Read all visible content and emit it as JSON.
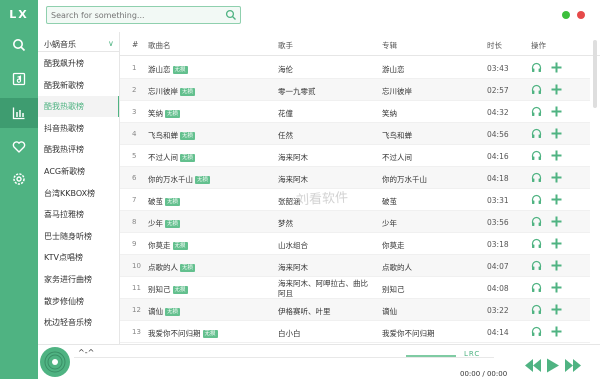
{
  "app": {
    "logo": "LX"
  },
  "sidebar_nav": {
    "icons": [
      "search-icon",
      "music-note-icon",
      "chart-icon",
      "heart-icon",
      "gear-icon"
    ],
    "active": "chart-icon"
  },
  "search": {
    "placeholder": "Search for something..."
  },
  "window_controls": {
    "colors": [
      "#3cbf3c",
      "#e64a4a"
    ]
  },
  "source_selector": {
    "value": "小蜗音乐"
  },
  "charts": [
    "酷我飙升榜",
    "酷我新歌榜",
    "酷我热歌榜",
    "抖音热歌榜",
    "酷我热评榜",
    "ACG新歌榜",
    "台湾KKBOX榜",
    "喜马拉雅榜",
    "巴士随身听榜",
    "KTV点唱榜",
    "家务进行曲榜",
    "散步修仙榜",
    "枕边轻音乐榜"
  ],
  "active_chart_index": 2,
  "table": {
    "headers": {
      "num": "#",
      "name": "歌曲名",
      "singer": "歌手",
      "album": "专辑",
      "duration": "时长",
      "ops": "操作"
    },
    "badge": "无损",
    "rows": [
      {
        "num": "1",
        "name": "游山恋",
        "badge": true,
        "singer": "海伦",
        "album": "游山恋",
        "dur": "03:43"
      },
      {
        "num": "2",
        "name": "忘川彼岸",
        "badge": true,
        "singer": "零一九零贰",
        "album": "忘川彼岸",
        "dur": "02:57"
      },
      {
        "num": "3",
        "name": "笑纳",
        "badge": true,
        "singer": "花僮",
        "album": "笑纳",
        "dur": "04:32"
      },
      {
        "num": "4",
        "name": "飞鸟和蝉",
        "badge": true,
        "singer": "任然",
        "album": "飞鸟和蝉",
        "dur": "04:56"
      },
      {
        "num": "5",
        "name": "不过人间",
        "badge": true,
        "singer": "海来阿木",
        "album": "不过人间",
        "dur": "04:16"
      },
      {
        "num": "6",
        "name": "你的万水千山",
        "badge": true,
        "singer": "海来阿木",
        "album": "你的万水千山",
        "dur": "04:18"
      },
      {
        "num": "7",
        "name": "破茧",
        "badge": true,
        "singer": "张韶涵",
        "album": "破茧",
        "dur": "03:31"
      },
      {
        "num": "8",
        "name": "少年",
        "badge": true,
        "singer": "梦然",
        "album": "少年",
        "dur": "03:56"
      },
      {
        "num": "9",
        "name": "你莫走",
        "badge": true,
        "singer": "山水组合",
        "album": "你莫走",
        "dur": "03:18"
      },
      {
        "num": "10",
        "name": "点歌的人",
        "badge": true,
        "singer": "海来阿木",
        "album": "点歌的人",
        "dur": "04:07"
      },
      {
        "num": "11",
        "name": "别知己",
        "badge": true,
        "singer": "海来阿木、阿呷拉古、曲比阿且",
        "album": "别知己",
        "dur": "04:08"
      },
      {
        "num": "12",
        "name": "谪仙",
        "badge": true,
        "singer": "伊格赛听、叶里",
        "album": "谪仙",
        "dur": "03:22"
      },
      {
        "num": "13",
        "name": "我爱你不问归期",
        "badge": true,
        "singer": "白小白",
        "album": "我爱你不问归期",
        "dur": "04:14"
      }
    ]
  },
  "player": {
    "title": "^-^",
    "lrc": "LRC",
    "time": "00:00 / 00:00"
  },
  "watermark": "刘看软件",
  "accent": "#4fb382"
}
